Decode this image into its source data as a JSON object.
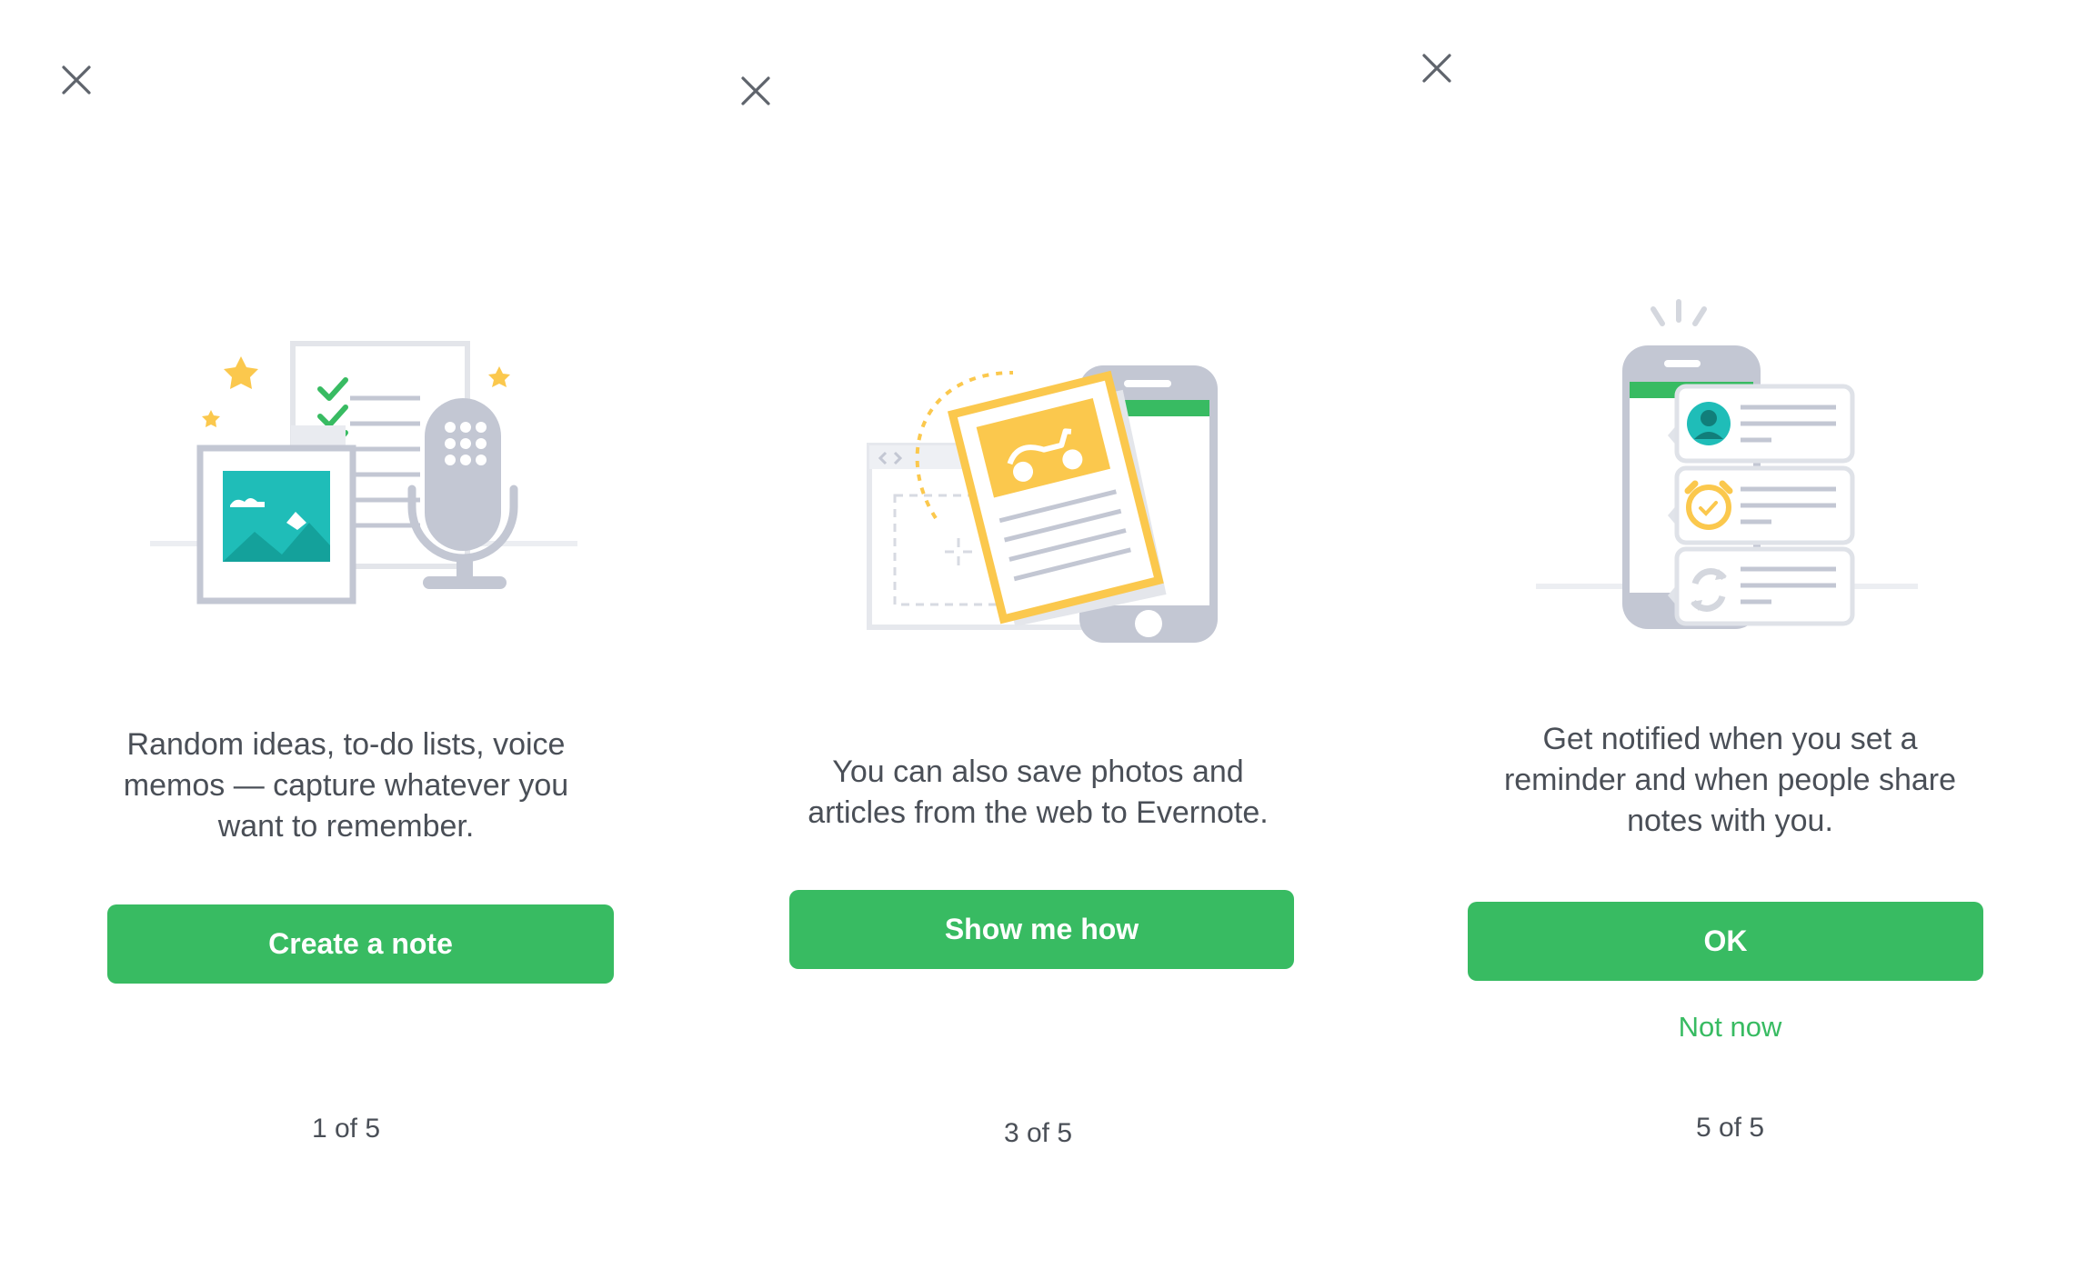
{
  "colors": {
    "accent_green": "#38bb62",
    "text": "#4a4f57",
    "illustration_gray": "#c3c7d3",
    "illustration_yellow": "#fbc84d",
    "illustration_teal": "#1fbdb8"
  },
  "panels": [
    {
      "close_icon": "close-icon",
      "illustration": "note-capture-illustration",
      "message_lines": [
        "Random ideas, to-do lists, voice",
        "memos — capture whatever you",
        "want to remember."
      ],
      "button_label": "Create a note",
      "pager": "1 of 5"
    },
    {
      "close_icon": "close-icon",
      "illustration": "web-clip-illustration",
      "message_lines": [
        "You can also save photos and",
        "articles from the web to Evernote."
      ],
      "button_label": "Show me how",
      "pager": "3 of 5"
    },
    {
      "close_icon": "close-icon",
      "illustration": "notifications-illustration",
      "message_lines": [
        "Get notified when you set a",
        "reminder and when people share",
        "notes with you."
      ],
      "button_label": "OK",
      "secondary_label": "Not now",
      "pager": "5 of 5"
    }
  ]
}
